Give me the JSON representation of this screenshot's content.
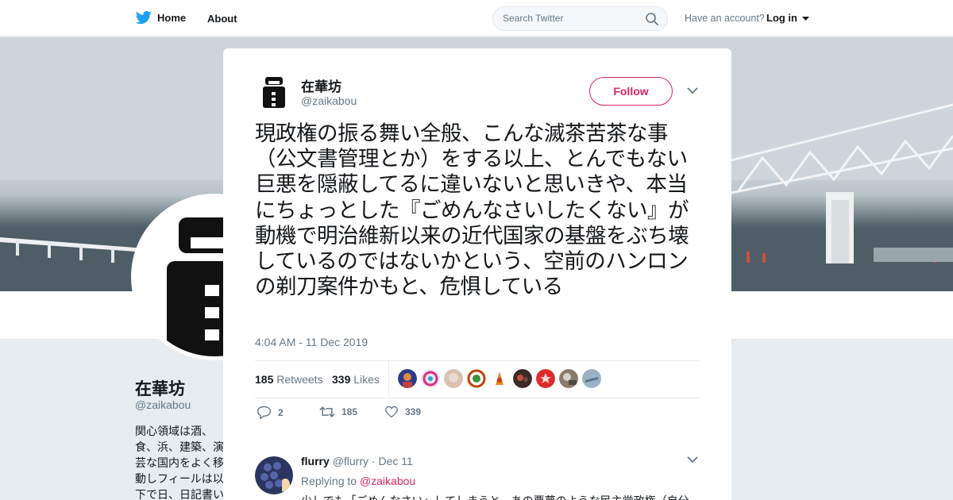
{
  "nav": {
    "home_label": "Home",
    "about_label": "About",
    "search_placeholder": "Search Twitter",
    "account_prompt": "Have an account?",
    "login_label": "Log in"
  },
  "background_profile": {
    "name": "在華坊",
    "handle": "@zaikabou",
    "bio": "関心領域は酒、食、浜、建築、演芸な国内をよく移動しフィールは以下で日、日記書いてま"
  },
  "tweet": {
    "author_name": "在華坊",
    "author_handle": "@zaikabou",
    "follow_label": "Follow",
    "text": "現政権の振る舞い全般、こんな滅茶苦茶な事（公文書管理とか）をする以上、とんでもない巨悪を隠蔽してるに違いないと思いきや、本当にちょっとした『ごめんなさいしたくない』が動機で明治維新以来の近代国家の基盤をぶち壊しているのではないかという、空前のハンロンの剃刀案件かもと、危惧している",
    "timestamp": "4:04 AM - 11 Dec 2019",
    "retweets_count": "185",
    "retweets_label": "Retweets",
    "likes_count": "339",
    "likes_label": "Likes",
    "reply_action_count": "2",
    "retweet_action_count": "185",
    "like_action_count": "339"
  },
  "reply": {
    "name": "flurry",
    "handle": "@flurry",
    "separator": "·",
    "date": "Dec 11",
    "replying_prefix": "Replying to",
    "replying_handle": "@zaikabou",
    "text": "少しでも「ごめんなさい」してしまうと、あの悪夢のような民主党政権（自分"
  },
  "colors": {
    "brand": "#1da1f2",
    "accent": "#e0245e",
    "secondary_text": "#657786",
    "border": "#e6ecf0"
  }
}
